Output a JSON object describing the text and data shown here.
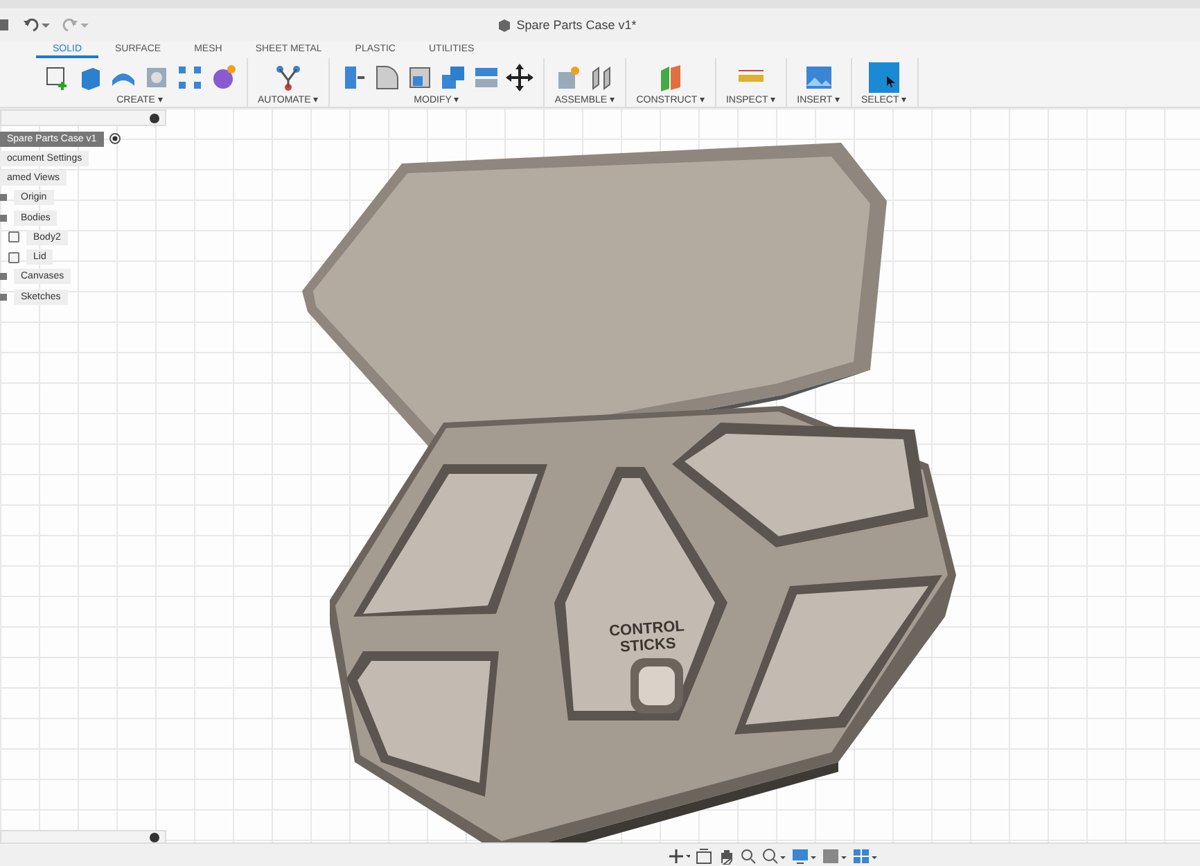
{
  "window": {
    "title": "Spare Parts Case v1*"
  },
  "tabs": [
    {
      "label": "SOLID",
      "selected": true
    },
    {
      "label": "SURFACE",
      "selected": false
    },
    {
      "label": "MESH",
      "selected": false
    },
    {
      "label": "SHEET METAL",
      "selected": false
    },
    {
      "label": "PLASTIC",
      "selected": false
    },
    {
      "label": "UTILITIES",
      "selected": false
    }
  ],
  "toolbar_groups": [
    {
      "label": "CREATE ▾"
    },
    {
      "label": "AUTOMATE ▾"
    },
    {
      "label": "MODIFY ▾"
    },
    {
      "label": "ASSEMBLE ▾"
    },
    {
      "label": "CONSTRUCT ▾"
    },
    {
      "label": "INSPECT ▾"
    },
    {
      "label": "INSERT ▾"
    },
    {
      "label": "SELECT ▾"
    }
  ],
  "browser": {
    "root": {
      "label": "Spare Parts Case v1",
      "selected": true
    },
    "items": [
      {
        "label": "ocument Settings",
        "kind": "plain"
      },
      {
        "label": "amed Views",
        "kind": "plain"
      },
      {
        "label": "Origin",
        "kind": "folder"
      },
      {
        "label": "Bodies",
        "kind": "folder",
        "children": [
          {
            "label": "Body2",
            "kind": "body"
          },
          {
            "label": "Lid",
            "kind": "body"
          }
        ]
      },
      {
        "label": "Canvases",
        "kind": "folder"
      },
      {
        "label": "Sketches",
        "kind": "folder"
      }
    ]
  },
  "model": {
    "engraving": [
      "CONTROL",
      "STICKS"
    ]
  }
}
